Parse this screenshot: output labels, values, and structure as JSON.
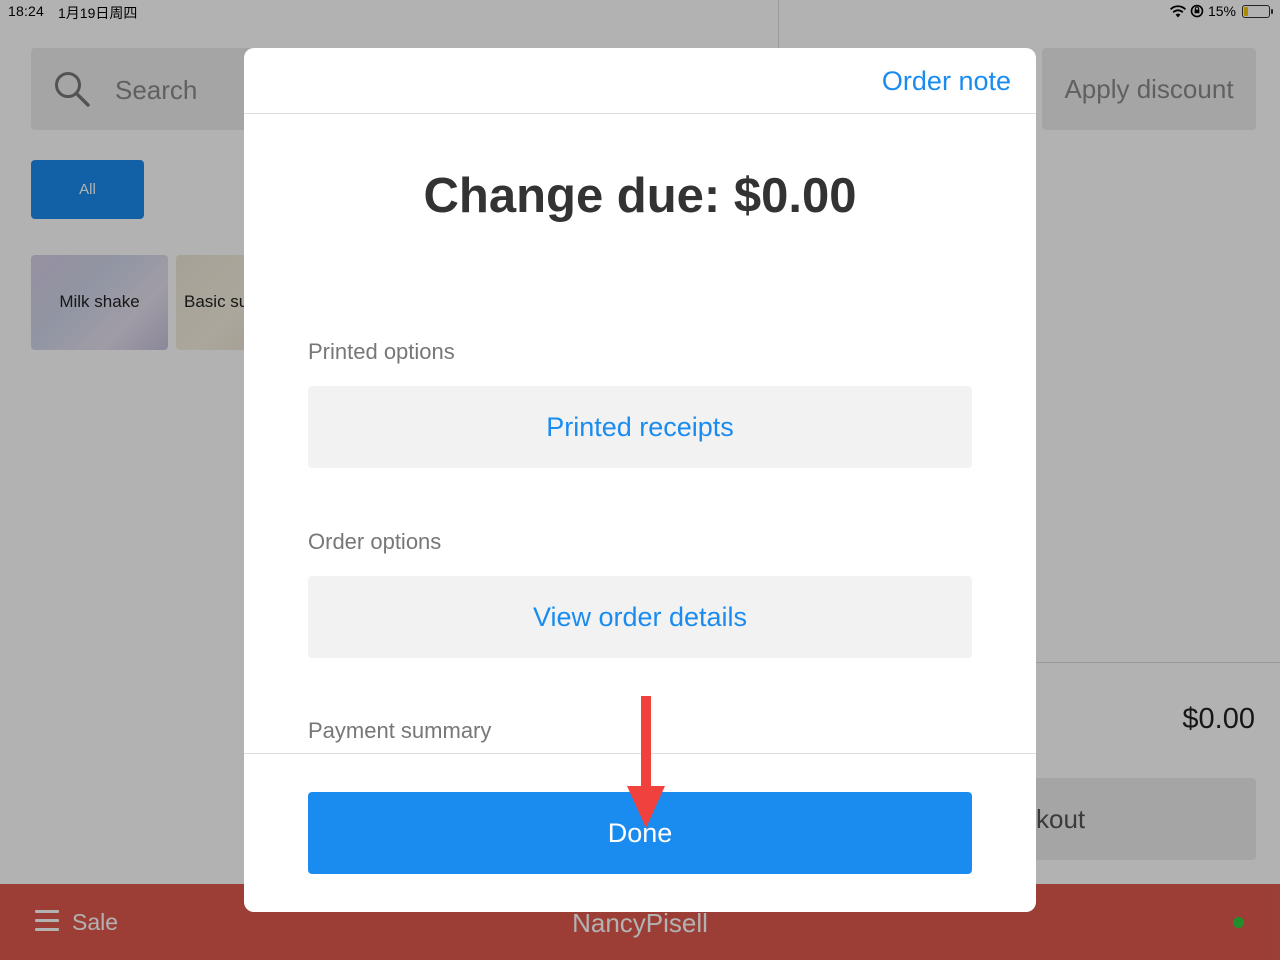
{
  "status_bar": {
    "time": "18:24",
    "date": "1月19日周四",
    "battery": "15%"
  },
  "search": {
    "placeholder": "Search"
  },
  "toolbar": {
    "apply_discount": "Apply discount"
  },
  "categories": [
    {
      "label": "All",
      "selected": true
    }
  ],
  "products": [
    {
      "name": "Milk shake"
    },
    {
      "name": "Basic su"
    }
  ],
  "cart": {
    "total": "$0.00",
    "checkout_label_partial": "kout"
  },
  "bottom_bar": {
    "section": "Sale",
    "user": "NancyPisell",
    "online": true
  },
  "modal": {
    "order_note": "Order note",
    "change_due": "Change due: $0.00",
    "printed_options_label": "Printed options",
    "printed_receipts": "Printed receipts",
    "order_options_label": "Order options",
    "view_order_details": "View order details",
    "payment_summary_label": "Payment summary",
    "done": "Done"
  },
  "colors": {
    "accent": "#1a8cf0",
    "bottom_bar": "#e05a4e",
    "online_dot": "#2ecc40",
    "annotation_arrow": "#f0413c"
  },
  "icons": {
    "search": "search-icon",
    "menu": "hamburger-menu-icon",
    "wifi": "wifi-icon",
    "lock": "orientation-lock-icon",
    "battery": "battery-icon"
  }
}
